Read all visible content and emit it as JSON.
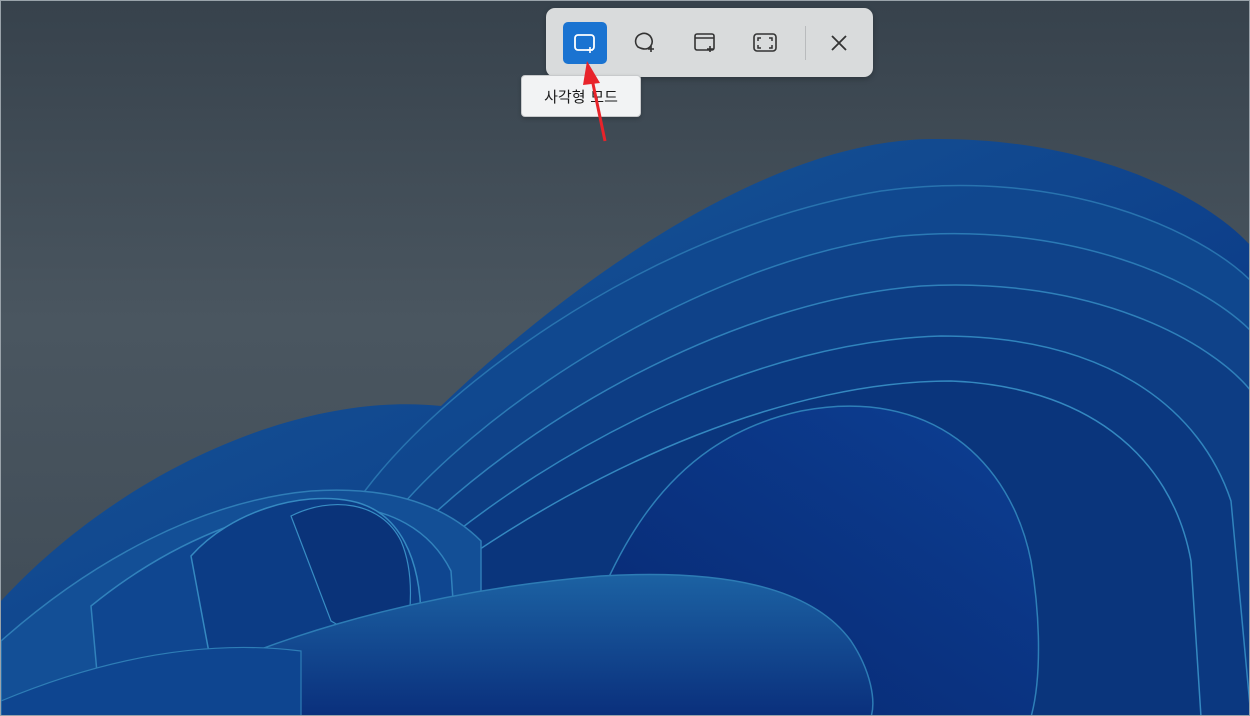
{
  "snipping_toolbar": {
    "modes": [
      {
        "id": "rectangle",
        "icon": "rectangle-snip-icon",
        "selected": true
      },
      {
        "id": "freeform",
        "icon": "freeform-snip-icon",
        "selected": false
      },
      {
        "id": "window",
        "icon": "window-snip-icon",
        "selected": false
      },
      {
        "id": "fullscreen",
        "icon": "fullscreen-snip-icon",
        "selected": false
      }
    ],
    "close_icon": "close-icon"
  },
  "tooltip": {
    "text": "사각형 모드"
  },
  "annotation": {
    "arrow_color": "#e8232a"
  },
  "colors": {
    "accent": "#1a73d1",
    "toolbar_bg": "#d9dbdc",
    "wallpaper_bg": "#4a555e",
    "bloom_blue": "#0b3f96"
  }
}
